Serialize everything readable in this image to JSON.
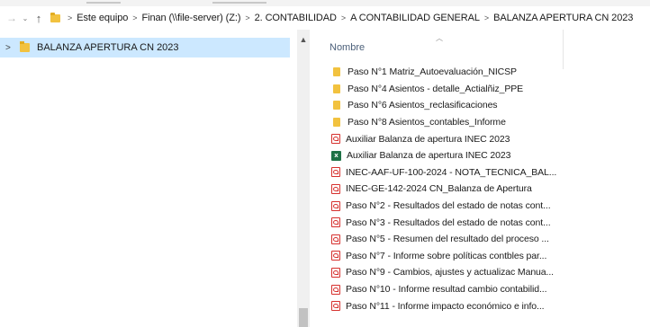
{
  "address_bar": {
    "breadcrumbs": [
      "Este equipo",
      "Finan (\\\\file-server) (Z:)",
      "2. CONTABILIDAD",
      "A CONTABILIDAD GENERAL",
      "BALANZA APERTURA CN 2023"
    ]
  },
  "nav_pane": {
    "selected_item": "BALANZA APERTURA CN 2023"
  },
  "file_list": {
    "column_header": "Nombre",
    "items": [
      {
        "name": "Paso N°1 Matriz_Autoevaluación_NICSP",
        "icon": "folder"
      },
      {
        "name": "Paso N°4 Asientos - detalle_Actialñiz_PPE",
        "icon": "folder"
      },
      {
        "name": "Paso N°6 Asientos_reclasificaciones",
        "icon": "folder"
      },
      {
        "name": "Paso N°8 Asientos_contables_Informe",
        "icon": "folder"
      },
      {
        "name": "Auxiliar Balanza de apertura INEC 2023",
        "icon": "pdf"
      },
      {
        "name": "Auxiliar Balanza de apertura INEC 2023",
        "icon": "xlsx"
      },
      {
        "name": "INEC-AAF-UF-100-2024 - NOTA_TECNICA_BAL...",
        "icon": "pdf"
      },
      {
        "name": "INEC-GE-142-2024 CN_Balanza de Apertura",
        "icon": "pdf"
      },
      {
        "name": "Paso N°2 - Resultados del estado de notas cont...",
        "icon": "pdf"
      },
      {
        "name": "Paso N°3 - Resultados del estado de notas cont...",
        "icon": "pdf"
      },
      {
        "name": "Paso N°5 - Resumen del resultado del proceso ...",
        "icon": "pdf"
      },
      {
        "name": "Paso N°7 - Informe sobre políticas contbles par...",
        "icon": "pdf"
      },
      {
        "name": "Paso N°9 - Cambios, ajustes y actualizac Manua...",
        "icon": "pdf"
      },
      {
        "name": "Paso N°10 - Informe resultad cambio contabilid...",
        "icon": "pdf"
      },
      {
        "name": "Paso N°11 - Informe impacto económico e info...",
        "icon": "pdf"
      }
    ]
  }
}
